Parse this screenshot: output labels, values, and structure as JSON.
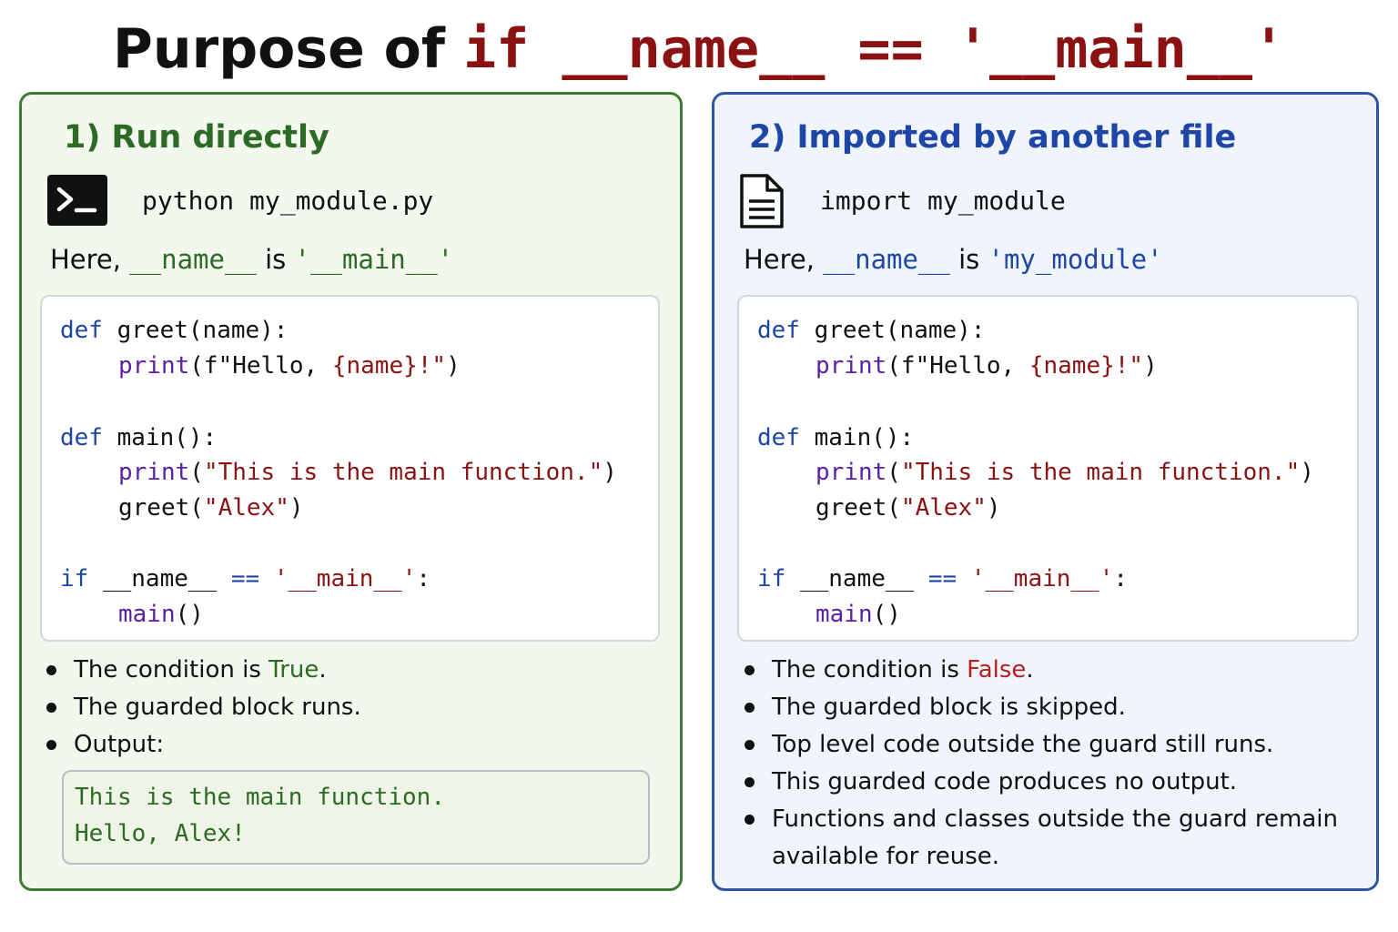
{
  "title": {
    "plain": "Purpose of",
    "code": "if __name__ == '__main__'"
  },
  "left": {
    "heading": "1) Run directly",
    "icon": "terminal-icon",
    "command": "python my_module.py",
    "here": {
      "prefix": "Here,",
      "name": "__name__",
      "is": "is",
      "value": "'__main__'"
    },
    "code": {
      "l1": {
        "kw": "def",
        "rest": " greet(name):"
      },
      "l2": {
        "fn": "print",
        "a": "(f\"Hello, ",
        "b": "{name}!\"",
        "c": ")"
      },
      "l3": {
        "kw": "def",
        "rest": " main():"
      },
      "l4": {
        "fn": "print",
        "a": "(",
        "b": "\"This is the main function.\"",
        "c": ")"
      },
      "l5": {
        "a": "greet(",
        "b": "\"Alex\"",
        "c": ")"
      },
      "l6": {
        "kw": "if",
        "a": " __name__ ",
        "op": "==",
        "sp": " ",
        "str": "'__main__'",
        "end": ":"
      },
      "l7": {
        "fn": "main",
        "rest": "()"
      }
    },
    "bullets": {
      "b1": {
        "text": "The condition is ",
        "value": "True",
        "end": "."
      },
      "b2": "The guarded block runs.",
      "b3": "Output:"
    },
    "output": [
      "This is the main function.",
      "Hello, Alex!"
    ]
  },
  "right": {
    "heading": "2) Imported by another file",
    "icon": "document-icon",
    "command": "import my_module",
    "here": {
      "prefix": "Here,",
      "name": "__name__",
      "is": "is",
      "value": "'my_module'"
    },
    "code": {
      "l1": {
        "kw": "def",
        "rest": " greet(name):"
      },
      "l2": {
        "fn": "print",
        "a": "(f\"Hello, ",
        "b": "{name}!\"",
        "c": ")"
      },
      "l3": {
        "kw": "def",
        "rest": " main():"
      },
      "l4": {
        "fn": "print",
        "a": "(",
        "b": "\"This is the main function.\"",
        "c": ")"
      },
      "l5": {
        "a": "greet(",
        "b": "\"Alex\"",
        "c": ")"
      },
      "l6": {
        "kw": "if",
        "a": " __name__ ",
        "op": "==",
        "sp": " ",
        "str": "'__main__'",
        "end": ":"
      },
      "l7": {
        "fn": "main",
        "rest": "()"
      }
    },
    "bullets": {
      "b1": {
        "text": "The condition is ",
        "value": "False",
        "end": "."
      },
      "b2": "The guarded block is skipped.",
      "b3": "Top level code outside the guard still runs.",
      "b4": "This guarded code produces no output.",
      "b5": "Functions and classes outside the guard remain available for reuse."
    }
  },
  "colors": {
    "title_code": "#8b1212",
    "left_accent": "#2c6a25",
    "right_accent": "#1f46a6",
    "false_value": "#b52020"
  }
}
